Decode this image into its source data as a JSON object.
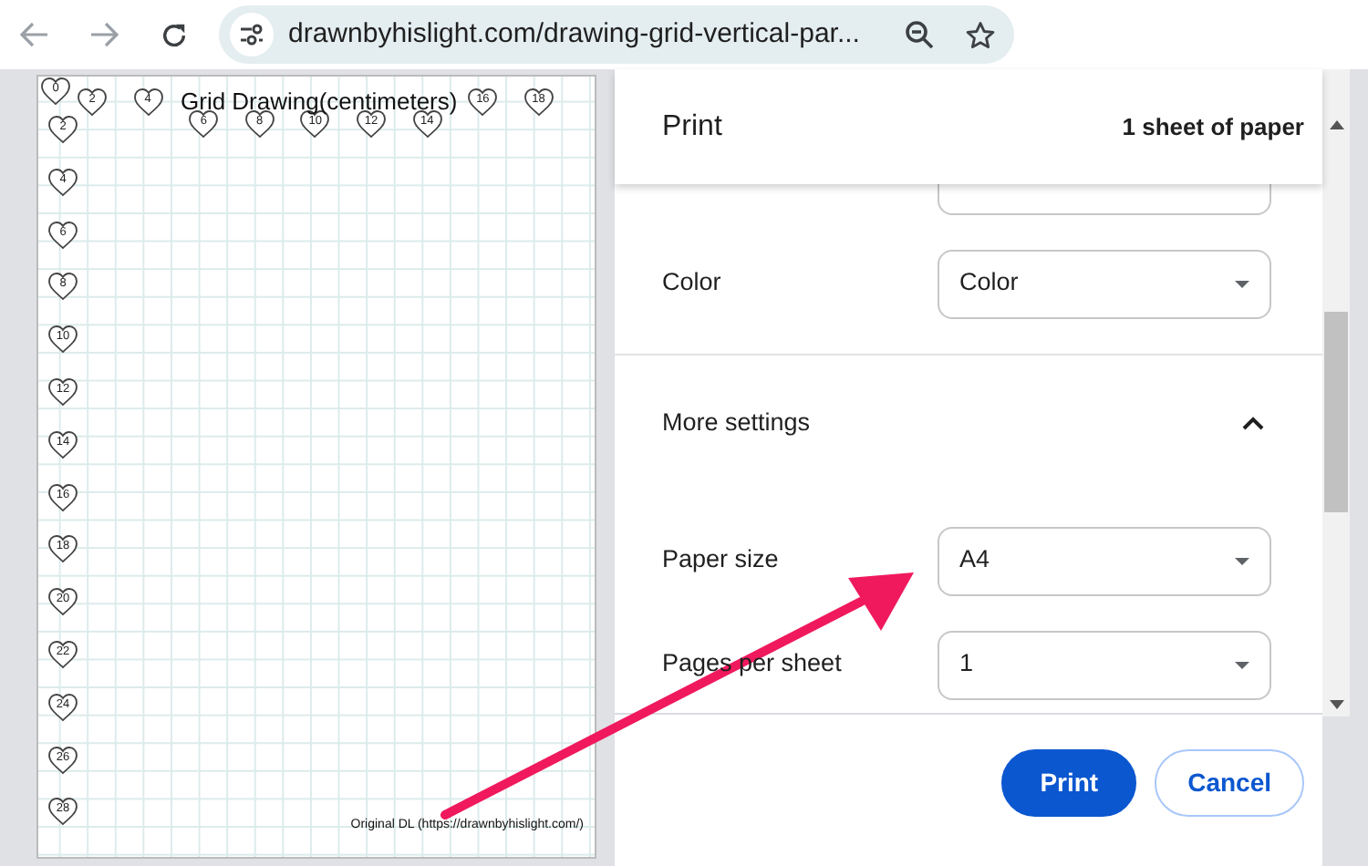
{
  "browser": {
    "url": "drawnbyhislight.com/drawing-grid-vertical-par..."
  },
  "preview": {
    "title": "Grid Drawing(centimeters)",
    "top_markers": [
      "0",
      "2",
      "4",
      "6",
      "8",
      "10",
      "12",
      "14",
      "16",
      "18"
    ],
    "left_markers": [
      "2",
      "4",
      "6",
      "8",
      "10",
      "12",
      "14",
      "16",
      "18",
      "20",
      "22",
      "24",
      "26",
      "28"
    ],
    "footer": "Original DL (https://drawnbyhislight.com/)"
  },
  "print_panel": {
    "title": "Print",
    "summary": "1 sheet of paper",
    "settings": [
      {
        "kind": "clipped_select"
      },
      {
        "kind": "select",
        "label": "Color",
        "value": "Color"
      },
      {
        "kind": "section",
        "label": "More settings",
        "expanded": true
      },
      {
        "kind": "select",
        "label": "Paper size",
        "value": "A4"
      },
      {
        "kind": "select",
        "label": "Pages per sheet",
        "value": "1"
      }
    ],
    "buttons": [
      {
        "kind": "primary",
        "label": "Print"
      },
      {
        "kind": "secondary",
        "label": "Cancel"
      }
    ]
  }
}
